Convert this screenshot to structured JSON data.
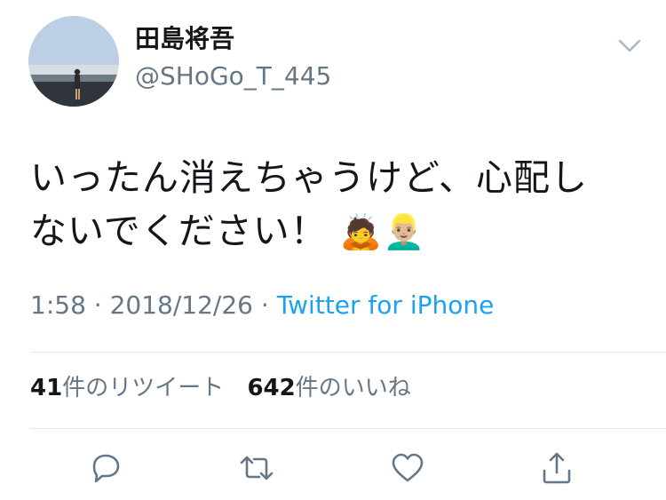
{
  "author": {
    "display_name": "田島将吾",
    "handle": "@SHoGo_T_445"
  },
  "tweet": {
    "text_line1": "いったん消えちゃうけど、心配し",
    "text_line2": "ないでください！",
    "emoji_1": "🙇",
    "emoji_2": "👱🏼‍♂️"
  },
  "meta": {
    "time": "1:58",
    "sep1": " · ",
    "date": "2018/12/26",
    "sep2": " · ",
    "source": "Twitter for iPhone"
  },
  "stats": {
    "retweets_count": "41",
    "retweets_label": "件のリツイート",
    "likes_count": "642",
    "likes_label": "件のいいね"
  },
  "actions": {
    "reply_icon": "reply-icon",
    "retweet_icon": "retweet-icon",
    "like_icon": "heart-icon",
    "share_icon": "share-icon"
  },
  "colors": {
    "text": "#14171a",
    "secondary": "#657786",
    "link": "#1da1f2",
    "divider": "#e1e8ed"
  }
}
